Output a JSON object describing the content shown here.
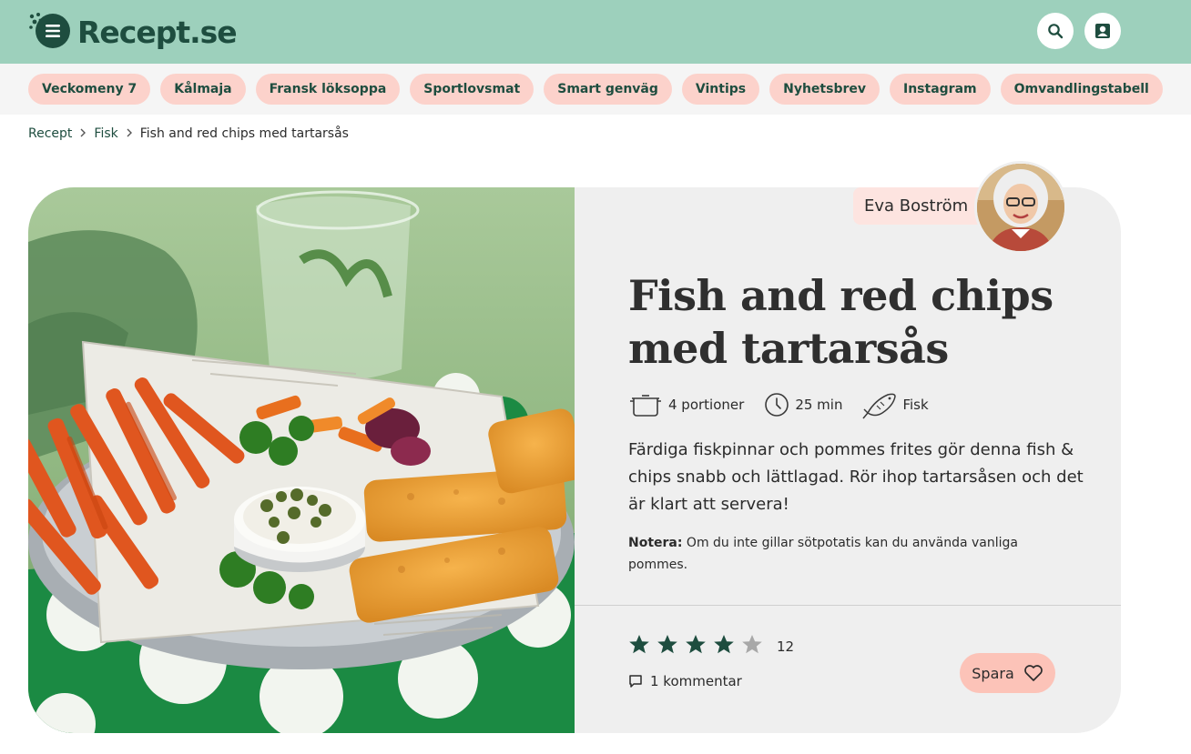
{
  "header": {
    "logo_text": "Recept.se",
    "menu_icon": "hamburger-menu-icon",
    "search_icon": "search-icon",
    "account_icon": "user-account-icon",
    "background_color": "#9dd0bc",
    "brand_color": "#1e4d3f"
  },
  "categories": {
    "items": [
      "Veckomeny 7",
      "Kålmaja",
      "Fransk löksoppa",
      "Sportlovsmat",
      "Smart genväg",
      "Vintips",
      "Nyhetsbrev",
      "Instagram",
      "Omvandlingstabell"
    ],
    "more": "·",
    "chip_color": "#fcd2cb"
  },
  "breadcrumb": {
    "items": [
      "Recept",
      "Fisk",
      "Fish and red chips med tartarsås"
    ]
  },
  "recipe": {
    "author": "Eva Boström",
    "title": "Fish and red chips med tartarsås",
    "meta": {
      "portions": "4 portioner",
      "time": "25 min",
      "category": "Fisk"
    },
    "description": "Färdiga fiskpinnar och pommes frites gör denna fish & chips snabb och lättlagad. Rör ihop tartarsåsen och det är klart att servera!",
    "note_label": "Notera:",
    "note_text": " Om du inte gillar sötpotatis kan du använda vanliga pommes.",
    "rating": {
      "value": 4,
      "max": 5,
      "count": "12",
      "filled_color": "#1e4d3f",
      "empty_color": "#a8a8a8"
    },
    "comments": "1 kommentar",
    "save_label": "Spara"
  }
}
